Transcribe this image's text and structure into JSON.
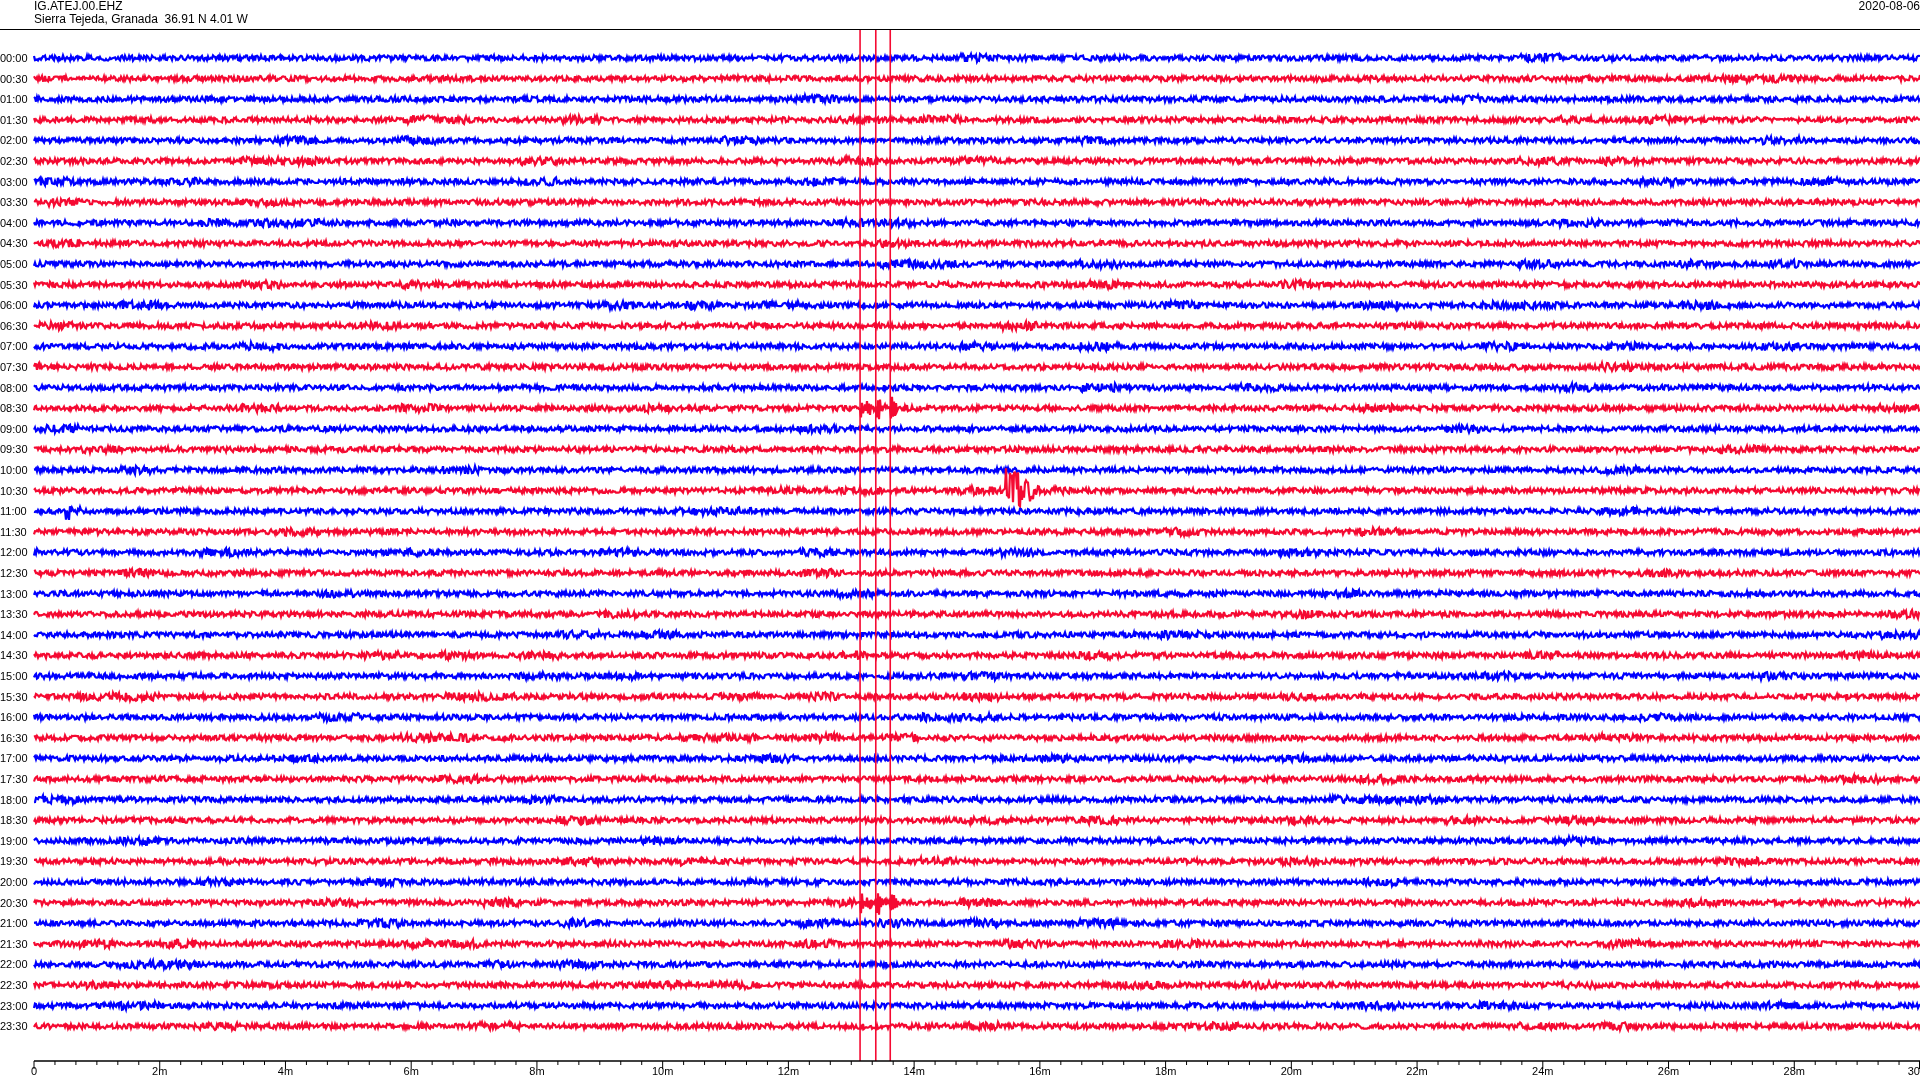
{
  "header": {
    "station": "IG.ATEJ.00.EHZ",
    "location": "Sierra Tejeda, Granada  36.91 N 4.01 W",
    "date": "2020-08-06"
  },
  "rows": [
    {
      "time": "00:00",
      "color": "#0000ff"
    },
    {
      "time": "00:30",
      "color": "#f50a32"
    },
    {
      "time": "01:00",
      "color": "#0000ff"
    },
    {
      "time": "01:30",
      "color": "#f50a32"
    },
    {
      "time": "02:00",
      "color": "#0000ff"
    },
    {
      "time": "02:30",
      "color": "#f50a32"
    },
    {
      "time": "03:00",
      "color": "#0000ff"
    },
    {
      "time": "03:30",
      "color": "#f50a32"
    },
    {
      "time": "04:00",
      "color": "#0000ff"
    },
    {
      "time": "04:30",
      "color": "#f50a32"
    },
    {
      "time": "05:00",
      "color": "#0000ff"
    },
    {
      "time": "05:30",
      "color": "#f50a32"
    },
    {
      "time": "06:00",
      "color": "#0000ff"
    },
    {
      "time": "06:30",
      "color": "#f50a32"
    },
    {
      "time": "07:00",
      "color": "#0000ff"
    },
    {
      "time": "07:30",
      "color": "#f50a32"
    },
    {
      "time": "08:00",
      "color": "#0000ff"
    },
    {
      "time": "08:30",
      "color": "#f50a32"
    },
    {
      "time": "09:00",
      "color": "#0000ff"
    },
    {
      "time": "09:30",
      "color": "#f50a32"
    },
    {
      "time": "10:00",
      "color": "#0000ff"
    },
    {
      "time": "10:30",
      "color": "#f50a32"
    },
    {
      "time": "11:00",
      "color": "#0000ff"
    },
    {
      "time": "11:30",
      "color": "#f50a32"
    },
    {
      "time": "12:00",
      "color": "#0000ff"
    },
    {
      "time": "12:30",
      "color": "#f50a32"
    },
    {
      "time": "13:00",
      "color": "#0000ff"
    },
    {
      "time": "13:30",
      "color": "#f50a32"
    },
    {
      "time": "14:00",
      "color": "#0000ff"
    },
    {
      "time": "14:30",
      "color": "#f50a32"
    },
    {
      "time": "15:00",
      "color": "#0000ff"
    },
    {
      "time": "15:30",
      "color": "#f50a32"
    },
    {
      "time": "16:00",
      "color": "#0000ff"
    },
    {
      "time": "16:30",
      "color": "#f50a32"
    },
    {
      "time": "17:00",
      "color": "#0000ff"
    },
    {
      "time": "17:30",
      "color": "#f50a32"
    },
    {
      "time": "18:00",
      "color": "#0000ff"
    },
    {
      "time": "18:30",
      "color": "#f50a32"
    },
    {
      "time": "19:00",
      "color": "#0000ff"
    },
    {
      "time": "19:30",
      "color": "#f50a32"
    },
    {
      "time": "20:00",
      "color": "#0000ff"
    },
    {
      "time": "20:30",
      "color": "#f50a32"
    },
    {
      "time": "21:00",
      "color": "#0000ff"
    },
    {
      "time": "21:30",
      "color": "#f50a32"
    },
    {
      "time": "22:00",
      "color": "#0000ff"
    },
    {
      "time": "22:30",
      "color": "#f50a32"
    },
    {
      "time": "23:00",
      "color": "#0000ff"
    },
    {
      "time": "23:30",
      "color": "#f50a32"
    }
  ],
  "x_axis": {
    "labels": [
      "0",
      "2m",
      "4m",
      "6m",
      "8m",
      "10m",
      "12m",
      "14m",
      "16m",
      "18m",
      "20m",
      "22m",
      "24m",
      "26m",
      "28m",
      "30"
    ]
  }
}
